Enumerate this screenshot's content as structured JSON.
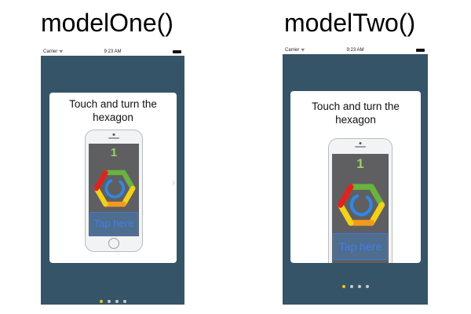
{
  "headings": {
    "one": "modelOne()",
    "two": "modelTwo()"
  },
  "status_bar": {
    "carrier": "Carrier ᯤ",
    "time": "9:23 AM"
  },
  "card": {
    "title_line1": "Touch and turn the",
    "title_line2": "hexagon"
  },
  "game": {
    "score": "1",
    "tap_label": "Tap here"
  },
  "navigation": {
    "next_glyph": "›",
    "page_count": 4,
    "current_page": 1
  },
  "colors": {
    "background": "#355468",
    "card": "#ffffff",
    "game_screen": "#5f5f61",
    "score": "#9ad16a",
    "tap_text": "#3f7fe8",
    "active_dot": "#f2c31a",
    "inactive_dot": "#c8ccd0",
    "hex_red": "#e0231e",
    "hex_green": "#69b33f",
    "hex_yellow": "#f2d11b",
    "hex_orange": "#f39a1c",
    "hex_blue": "#2f88e5"
  },
  "icons": {
    "hexagon": "hexagon-rotate-icon",
    "chevron": "chevron-right-icon"
  }
}
